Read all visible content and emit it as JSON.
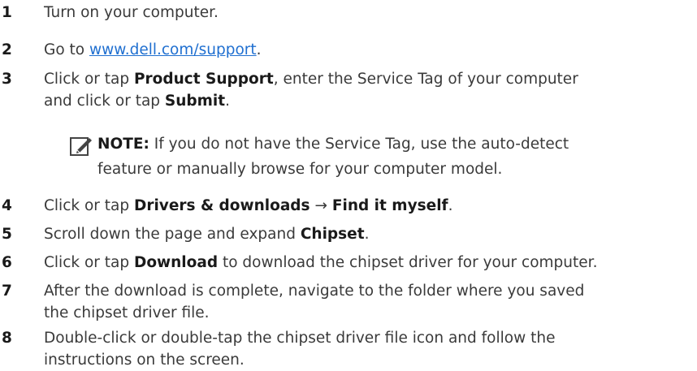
{
  "steps": [
    {
      "num": "1",
      "parts": [
        {
          "t": "Turn on your computer."
        }
      ]
    },
    {
      "num": "2",
      "parts": [
        {
          "t": "Go to "
        },
        {
          "t": "www.dell.com/support",
          "link": true
        },
        {
          "t": "."
        }
      ]
    },
    {
      "num": "3",
      "line1": [
        {
          "t": "Click or tap "
        },
        {
          "t": "Product Support",
          "b": true
        },
        {
          "t": ", enter the Service Tag of your computer"
        }
      ],
      "line2": [
        {
          "t": "and click or tap "
        },
        {
          "t": "Submit",
          "b": true
        },
        {
          "t": "."
        }
      ]
    },
    {
      "num": "4",
      "parts": [
        {
          "t": "Click or tap "
        },
        {
          "t": "Drivers & downloads",
          "b": true
        },
        {
          "t": " → "
        },
        {
          "t": "Find it myself",
          "b": true
        },
        {
          "t": "."
        }
      ]
    },
    {
      "num": "5",
      "parts": [
        {
          "t": "Scroll down the page and expand "
        },
        {
          "t": "Chipset",
          "b": true
        },
        {
          "t": "."
        }
      ]
    },
    {
      "num": "6",
      "parts": [
        {
          "t": "Click or tap "
        },
        {
          "t": "Download",
          "b": true
        },
        {
          "t": " to download the chipset driver for your computer."
        }
      ]
    },
    {
      "num": "7",
      "line1": [
        {
          "t": "After the download is complete, navigate to the folder where you saved"
        }
      ],
      "line2": [
        {
          "t": "the chipset driver file."
        }
      ]
    },
    {
      "num": "8",
      "line1": [
        {
          "t": "Double-click or double-tap the chipset driver file icon and follow the"
        }
      ],
      "line2": [
        {
          "t": "instructions on the screen."
        }
      ]
    }
  ],
  "note": {
    "label": "NOTE:",
    "line1": " If you do not have the Service Tag, use the auto-detect",
    "line2": "feature or manually browse for your computer model.",
    "icon": "pencil-note-icon"
  }
}
